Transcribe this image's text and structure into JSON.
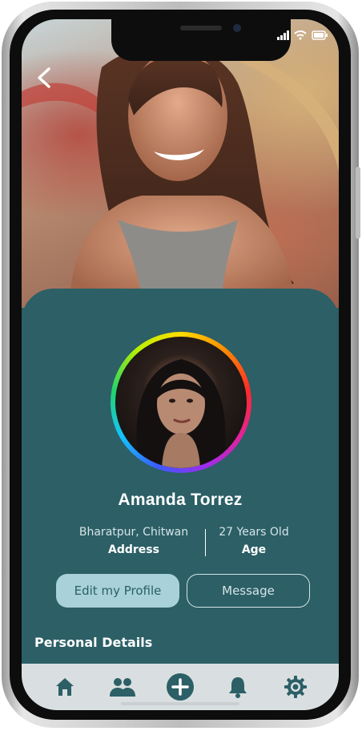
{
  "profile": {
    "name": "Amanda Torrez",
    "address_value": "Bharatpur, Chitwan",
    "address_label": "Address",
    "age_value": "27 Years Old",
    "age_label": "Age"
  },
  "actions": {
    "edit_label": "Edit my Profile",
    "message_label": "Message"
  },
  "section": {
    "title": "Personal Details"
  },
  "icons": {
    "back": "chevron-left-icon",
    "signal": "signal-icon",
    "wifi": "wifi-icon",
    "battery": "battery-icon",
    "home": "home-icon",
    "people": "people-icon",
    "add": "plus-circle-icon",
    "bell": "bell-icon",
    "settings": "gear-icon"
  },
  "colors": {
    "primary": "#2c5f66",
    "button_fill": "#a8d1d9",
    "tabbar": "#d9dfe0"
  }
}
